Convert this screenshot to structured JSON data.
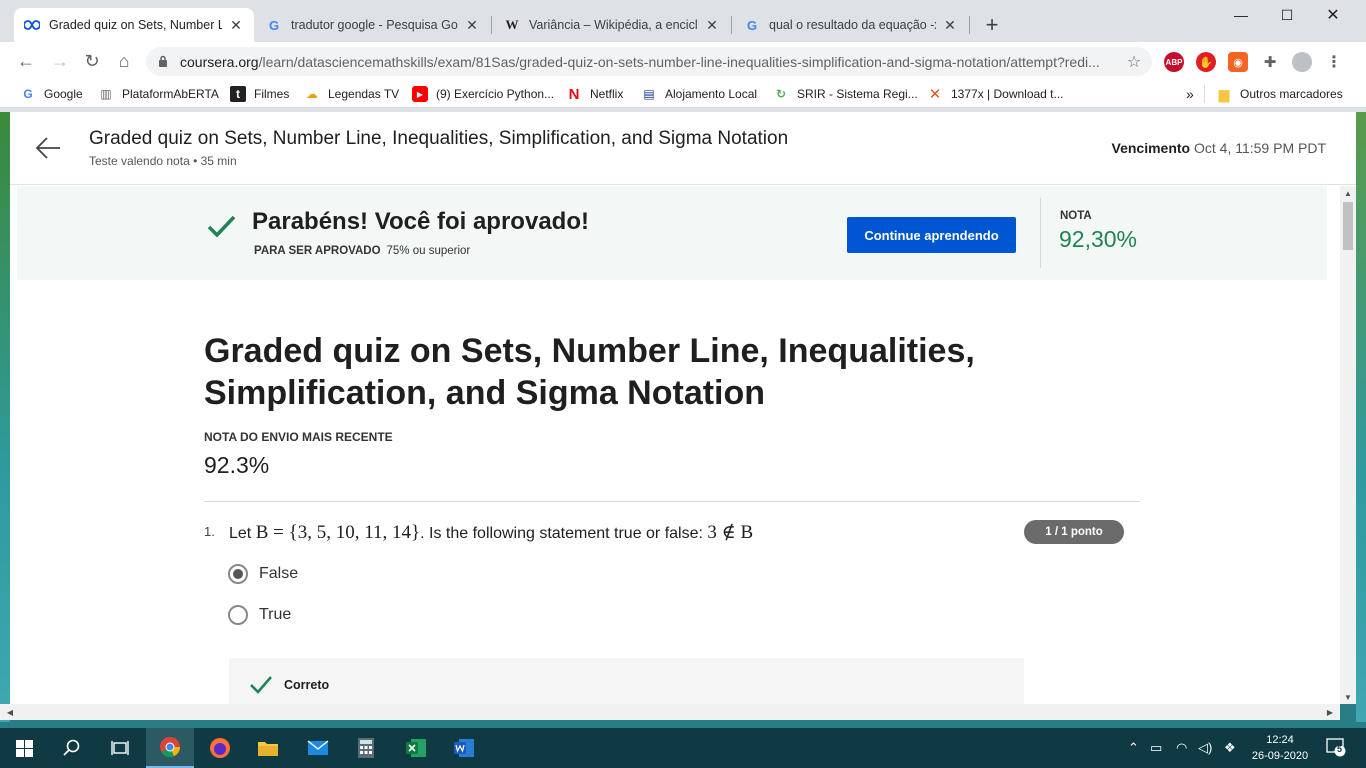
{
  "browser": {
    "tabs": [
      {
        "title": "Graded quiz on Sets, Number Lin",
        "favicon": "coursera-icon",
        "active": true
      },
      {
        "title": "tradutor google - Pesquisa Goog",
        "favicon": "google-icon",
        "active": false
      },
      {
        "title": "Variância – Wikipédia, a enciclop",
        "favicon": "wikipedia-icon",
        "active": false
      },
      {
        "title": "qual o resultado da equação -x <",
        "favicon": "google-icon",
        "active": false
      }
    ],
    "new_tab": "+",
    "url_host": "coursera.org",
    "url_path": "/learn/datasciencemathskills/exam/81Sas/graded-quiz-on-sets-number-line-inequalities-simplification-and-sigma-notation/attempt?redi...",
    "extensions": [
      {
        "name": "adblock-plus-icon",
        "label": "ABP",
        "color": "#c70d2c"
      },
      {
        "name": "adblock-icon",
        "label": "✋",
        "color": "#e02020"
      },
      {
        "name": "rss-icon",
        "label": "◉",
        "color": "#f26522"
      }
    ],
    "bookmarks": [
      {
        "label": "Google",
        "icon": "google-icon"
      },
      {
        "label": "PlataformAbERTA",
        "icon": "building-icon"
      },
      {
        "label": "Filmes",
        "icon": "t-icon"
      },
      {
        "label": "Legendas TV",
        "icon": "cloud-icon"
      },
      {
        "label": "(9) Exercício Python...",
        "icon": "youtube-icon"
      },
      {
        "label": "Netflix",
        "icon": "netflix-icon"
      },
      {
        "label": "Alojamento Local",
        "icon": "flag-icon"
      },
      {
        "label": "SRIR - Sistema Regi...",
        "icon": "swirl-icon"
      },
      {
        "label": "1377x | Download t...",
        "icon": "x-icon"
      }
    ],
    "more_bookmarks": "»",
    "other_bookmarks": "Outros marcadores"
  },
  "header": {
    "title": "Graded quiz on Sets, Number Line, Inequalities, Simplification, and Sigma Notation",
    "subtitle": "Teste valendo nota • 35 min",
    "due_label": "Vencimento",
    "due_value": "Oct 4, 11:59 PM PDT"
  },
  "banner": {
    "title": "Parabéns! Você foi aprovado!",
    "pass_label": "PARA SER APROVADO",
    "pass_value": "75% ou superior",
    "continue_button": "Continue aprendendo",
    "grade_label": "NOTA",
    "grade_value": "92,30%"
  },
  "quiz": {
    "title": "Graded quiz on Sets, Number Line, Inequalities, Simplification, and Sigma Notation",
    "recent_label": "NOTA DO ENVIO MAIS RECENTE",
    "recent_value": "92.3%",
    "question": {
      "number": "1.",
      "text_prefix": "Let",
      "math_set": "B = {3, 5, 10, 11, 14}",
      "text_middle": ". Is the following statement true or false:",
      "math_statement": "3 ∉ B",
      "points": "1 / 1 ponto",
      "options": [
        {
          "label": "False",
          "selected": true
        },
        {
          "label": "True",
          "selected": false
        }
      ],
      "feedback": "Correto"
    }
  },
  "taskbar": {
    "apps": [
      "windows-start-icon",
      "search-icon",
      "task-view-icon",
      "chrome-icon",
      "firefox-icon",
      "file-explorer-icon",
      "mail-icon",
      "calculator-icon",
      "excel-icon",
      "word-icon"
    ],
    "time": "12:24",
    "date": "26-09-2020",
    "notifications": "5"
  },
  "colors": {
    "accent_blue": "#0056d2",
    "success_green": "#1f8354",
    "banner_bg": "#f3f8f7"
  }
}
